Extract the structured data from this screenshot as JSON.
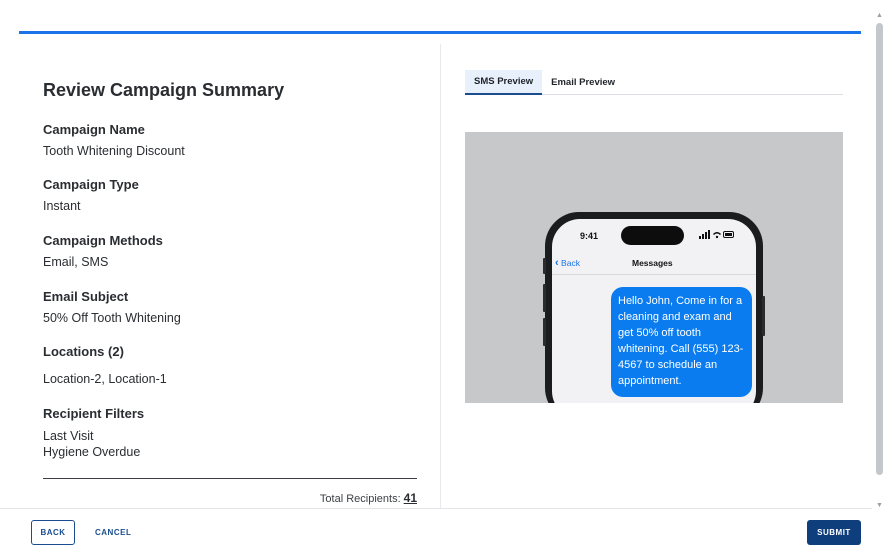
{
  "colors": {
    "accent": "#1a73e8",
    "primary_button": "#0f3e7c",
    "bubble": "#0a7cf0"
  },
  "summary": {
    "title": "Review Campaign Summary",
    "fields": [
      {
        "label": "Campaign Name",
        "value": "Tooth Whitening Discount"
      },
      {
        "label": "Campaign Type",
        "value": "Instant"
      },
      {
        "label": "Campaign Methods",
        "value": "Email, SMS"
      },
      {
        "label": "Email Subject",
        "value": "50% Off Tooth Whitening"
      },
      {
        "label": "Locations (2)",
        "value": "Location-2, Location-1"
      },
      {
        "label": "Recipient Filters",
        "values": [
          "Last Visit",
          "Hygiene Overdue"
        ]
      }
    ],
    "total_label": "Total Recipients:",
    "total_count": "41"
  },
  "preview": {
    "tabs": [
      {
        "label": "SMS Preview",
        "active": true
      },
      {
        "label": "Email Preview",
        "active": false
      }
    ],
    "phone": {
      "time": "9:41",
      "back_label": "Back",
      "back_icon": "chevron-left-icon",
      "nav_title": "Messages",
      "message": "Hello John, Come in for a cleaning and exam and get 50% off tooth whitening. Call (555) 123-4567 to schedule an appointment."
    }
  },
  "footer": {
    "back_label": "BACK",
    "cancel_label": "CANCEL",
    "submit_label": "SUBMIT"
  }
}
